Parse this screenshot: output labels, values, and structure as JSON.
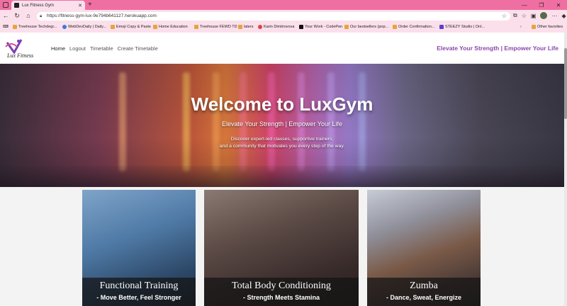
{
  "browser": {
    "tab_title": "Lux Fitness Gym",
    "url": "https://fitness-gym-lux-9e794b641127.herokuapp.com",
    "bookmarks": [
      "Treehouse Techdegr...",
      "WebDevDaily | Daily...",
      "Emoji Copy & Paste",
      "Home Education",
      "Treehouse FEWD TD",
      "laters",
      "Karin Dimitrovova",
      "Your Work - CodePen",
      "Our bestsellers (pop...",
      "Order Confirmation...",
      "STEEZY Studio | Onl..."
    ],
    "other_favorites": "Other favorites"
  },
  "site": {
    "logo_text": "Lux Fitness",
    "nav": [
      "Home",
      "Logout",
      "Timetable",
      "Create Timetable"
    ],
    "slogan": "Elevate Your Strength | Empower Your Life"
  },
  "hero": {
    "title": "Welcome to LuxGym",
    "subtitle": "Elevate Your Strength | Empower Your Life",
    "desc_line1": "Discover expert-led classes, supportive trainers,",
    "desc_line2": "and a community that motivates you every step of the way."
  },
  "cards": [
    {
      "title": "Functional Training",
      "tagline": "- Move Better, Feel Stronger"
    },
    {
      "title": "Total Body Conditioning",
      "tagline": "- Strength Meets Stamina"
    },
    {
      "title": "Zumba",
      "tagline": "- Dance, Sweat, Energize"
    }
  ],
  "colors": {
    "browser_accent": "#f06fa2",
    "slogan": "#8e44ad"
  }
}
